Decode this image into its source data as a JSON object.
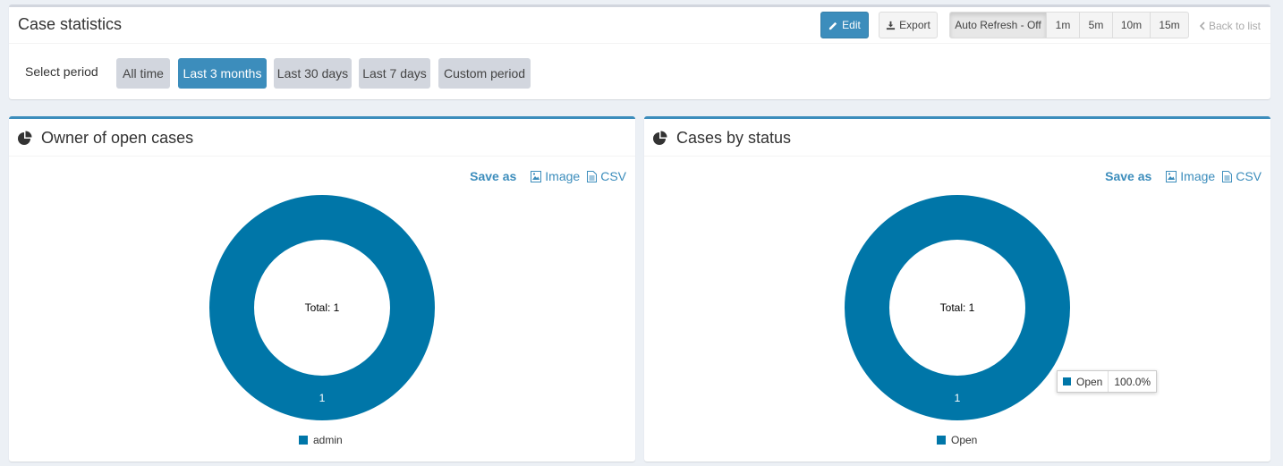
{
  "header": {
    "title": "Case statistics",
    "edit_label": "Edit",
    "export_label": "Export",
    "auto_refresh": [
      "Auto Refresh - Off",
      "1m",
      "5m",
      "10m",
      "15m"
    ],
    "back_label": "Back to list"
  },
  "period": {
    "label": "Select period",
    "options": [
      "All time",
      "Last 3 months",
      "Last 30 days",
      "Last 7 days",
      "Custom period"
    ],
    "selected": "Last 3 months"
  },
  "colors": {
    "accent": "#3c8dbc",
    "donut": "#0076a8"
  },
  "save": {
    "label": "Save as",
    "image": "Image",
    "csv": "CSV"
  },
  "chart_data": [
    {
      "type": "pie",
      "title": "Owner of open cases",
      "center_text": "Total: 1",
      "slices": [
        {
          "label": "admin",
          "value": 1
        }
      ]
    },
    {
      "type": "pie",
      "title": "Cases by status",
      "center_text": "Total: 1",
      "slices": [
        {
          "label": "Open",
          "value": 1
        }
      ],
      "tooltip": {
        "label": "Open",
        "value": "100.0%"
      }
    }
  ]
}
